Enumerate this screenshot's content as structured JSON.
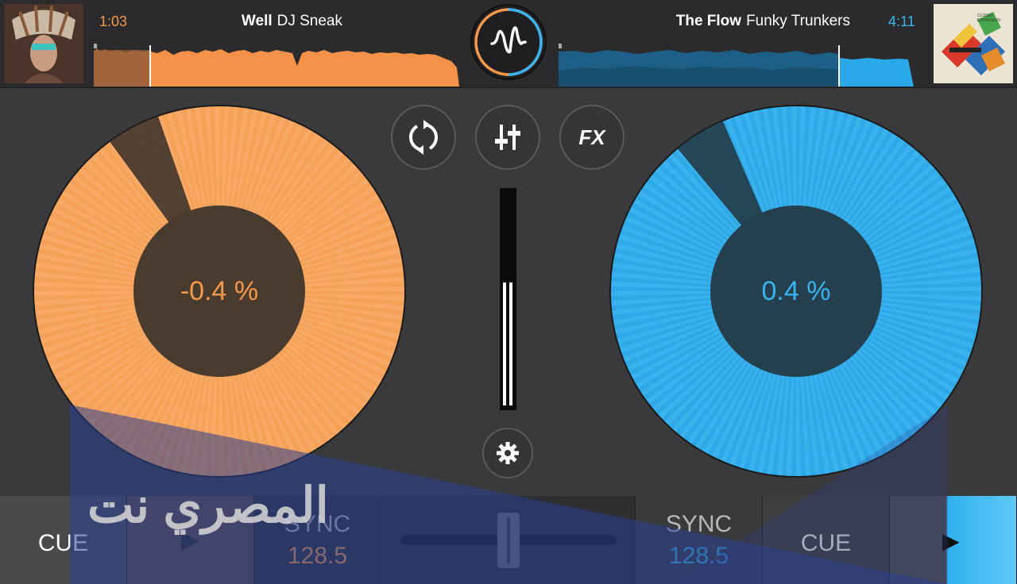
{
  "deck_a": {
    "time": "1:03",
    "title": "Well",
    "artist": "DJ Sneak",
    "pitch": "-0.4 %",
    "accent": "#f7994a"
  },
  "deck_b": {
    "time": "4:11",
    "title": "The Flow",
    "artist": "Funky Trunkers",
    "pitch": "0.4 %",
    "accent": "#3ab4ef",
    "cover_text": "CLOSED EXPANSION"
  },
  "controls": {
    "loop_icon": "loop-icon",
    "mixer_icon": "mixer-icon",
    "fx_label": "FX",
    "settings_icon": "gear-icon"
  },
  "bottom": {
    "cue_left": "CUE",
    "sync_left_label": "SYNC",
    "sync_left_bpm": "128.5",
    "sync_right_label": "SYNC",
    "sync_right_bpm": "128.5",
    "cue_right": "CUE",
    "play_glyph": "▶",
    "play_left_glyph": "▶"
  },
  "watermark": "المصري نت"
}
